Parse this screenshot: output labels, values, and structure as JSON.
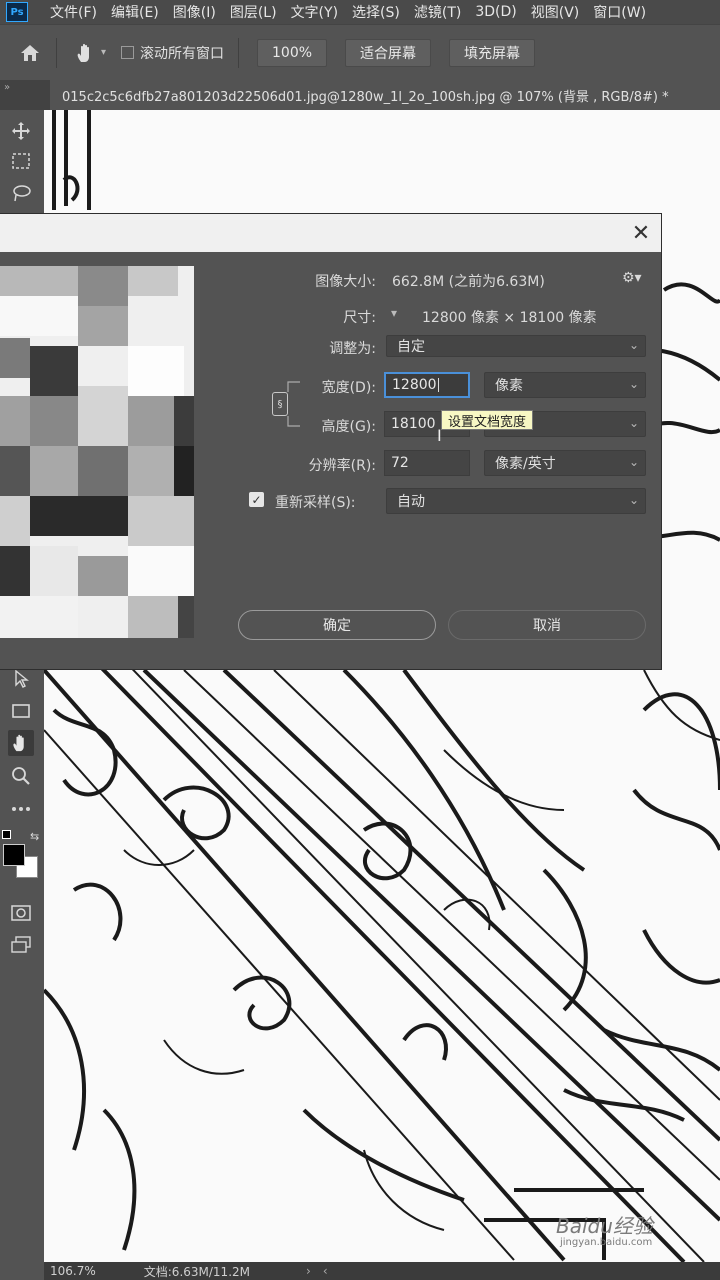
{
  "menu": {
    "logo": "Ps",
    "items": [
      "文件(F)",
      "编辑(E)",
      "图像(I)",
      "图层(L)",
      "文字(Y)",
      "选择(S)",
      "滤镜(T)",
      "3D(D)",
      "视图(V)",
      "窗口(W)"
    ]
  },
  "options": {
    "scroll_all_label": "滚动所有窗口",
    "zoom_btn": "100%",
    "fit_btn": "适合屏幕",
    "fill_btn": "填充屏幕"
  },
  "document": {
    "tab_title": "015c2c5c6dfb27a801203d22506d01.jpg@1280w_1l_2o_100sh.jpg @ 107% (背景 , RGB/8#) *"
  },
  "status": {
    "zoom": "106.7%",
    "doc_size": "文档:6.63M/11.2M"
  },
  "dialog": {
    "image_size_label": "图像大小:",
    "image_size_value": "662.8M (之前为6.63M)",
    "dimensions_label": "尺寸:",
    "dimensions_value": "12800 像素  ×  18100 像素",
    "fit_to_label": "调整为:",
    "fit_to_value": "自定",
    "width_label": "宽度(D):",
    "width_value": "12800",
    "width_unit": "像素",
    "height_label": "高度(G):",
    "height_value": "18100",
    "height_unit": "像素",
    "resolution_label": "分辨率(R):",
    "resolution_value": "72",
    "resolution_unit": "像素/英寸",
    "resample_label": "重新采样(S):",
    "resample_checked": true,
    "resample_value": "自动",
    "ok_label": "确定",
    "cancel_label": "取消",
    "tooltip": "设置文档宽度"
  },
  "watermark": {
    "text": "Baidu经验",
    "sub": "jingyan.baidu.com"
  }
}
